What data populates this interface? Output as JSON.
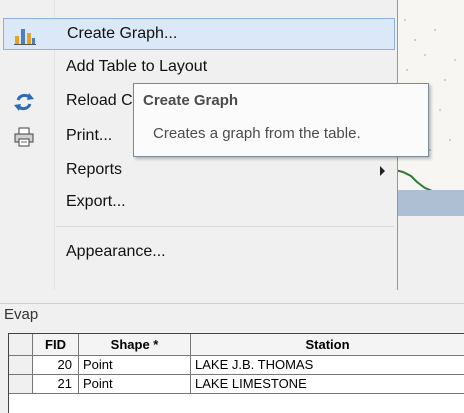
{
  "menu": {
    "items": [
      {
        "label": "Create Graph...",
        "icon": "bar-chart-icon",
        "highlighted": true
      },
      {
        "label": "Add Table to Layout",
        "icon": ""
      },
      {
        "label": "Reload Cache",
        "icon": "reload-icon"
      },
      {
        "label": "Print...",
        "icon": "printer-icon"
      },
      {
        "label": "Reports",
        "icon": "",
        "submenu": true
      },
      {
        "label": "Export...",
        "icon": ""
      },
      {
        "label": "Appearance...",
        "icon": ""
      }
    ]
  },
  "tooltip": {
    "title": "Create Graph",
    "description": "Creates a graph from the table."
  },
  "table": {
    "title": "Evap",
    "columns": [
      "FID",
      "Shape *",
      "Station"
    ],
    "rows": [
      {
        "fid": "20",
        "shape": "Point",
        "station": "LAKE J.B. THOMAS"
      },
      {
        "fid": "21",
        "shape": "Point",
        "station": "LAKE LIMESTONE"
      }
    ]
  },
  "colors": {
    "highlight": "#dbe8f7",
    "highlight_border": "#8fb1dd",
    "strip": "#aebfd3",
    "map_line": "#2f7a3a"
  }
}
